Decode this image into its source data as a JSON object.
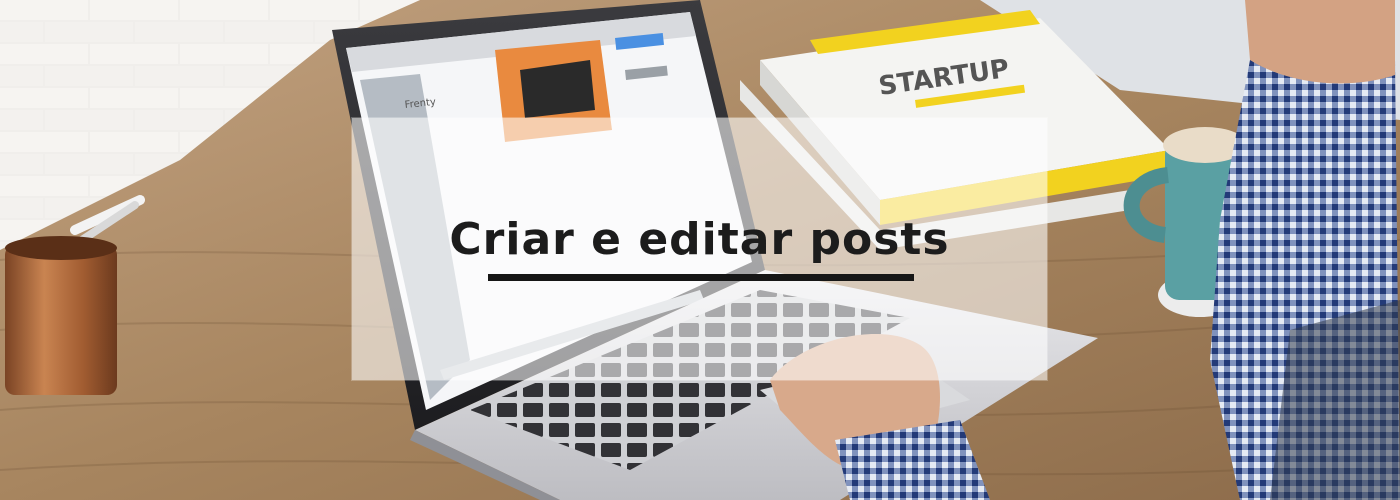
{
  "banner": {
    "title": "Criar e editar posts"
  },
  "laptop_screen": {
    "profile_name": "Frenty",
    "book_title": "STARTUP"
  },
  "colors": {
    "overlay": "rgba(255,255,255,0.58)",
    "title_text": "#1c1c1c",
    "underline": "#161616",
    "desk": "#a98763",
    "brick_wall": "#e9e7e2",
    "book_yellow": "#f2d21f",
    "mug_teal": "#5aa0a3",
    "cup_copper": "#b86f3f",
    "shirt_blue": "#2f4a8a"
  },
  "icons": [
    "pencil-cup",
    "laptop",
    "book",
    "coffee-mug",
    "hand"
  ]
}
